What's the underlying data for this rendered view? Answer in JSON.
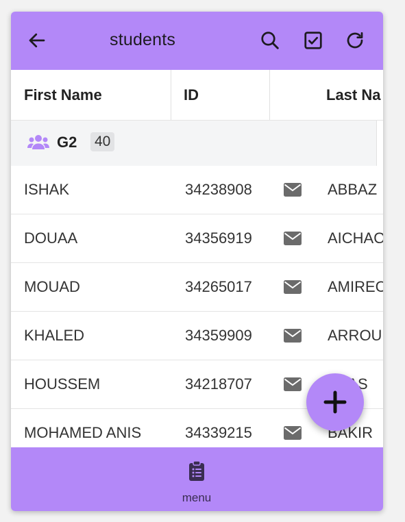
{
  "appbar": {
    "title": "students",
    "back_icon": "arrow-left-icon",
    "search_icon": "search-icon",
    "select_icon": "checkbox-icon",
    "refresh_icon": "refresh-icon"
  },
  "table": {
    "columns": [
      "First Name",
      "ID",
      "Last Na"
    ],
    "group": {
      "name": "G2",
      "count": "40",
      "icon": "users-icon"
    },
    "rows": [
      {
        "first_name": "ISHAK",
        "id": "34238908",
        "last_name": "ABBAZ"
      },
      {
        "first_name": "DOUAA",
        "id": "34356919",
        "last_name": "AICHAO"
      },
      {
        "first_name": "MOUAD",
        "id": "34265017",
        "last_name": "AMIREC"
      },
      {
        "first_name": "KHALED",
        "id": "34359909",
        "last_name": "ARROUI"
      },
      {
        "first_name": "HOUSSEM",
        "id": "34218707",
        "last_name": "BAAS"
      },
      {
        "first_name": "MOHAMED ANIS",
        "id": "34339215",
        "last_name": "BAKIR"
      }
    ]
  },
  "fab": {
    "icon": "plus-icon"
  },
  "bottom_nav": {
    "items": [
      {
        "label": "menu",
        "icon": "clipboard-list-icon"
      }
    ]
  },
  "colors": {
    "accent": "#b388f8",
    "group_icon": "#b388f8",
    "mail_icon": "#6b6b6b"
  }
}
